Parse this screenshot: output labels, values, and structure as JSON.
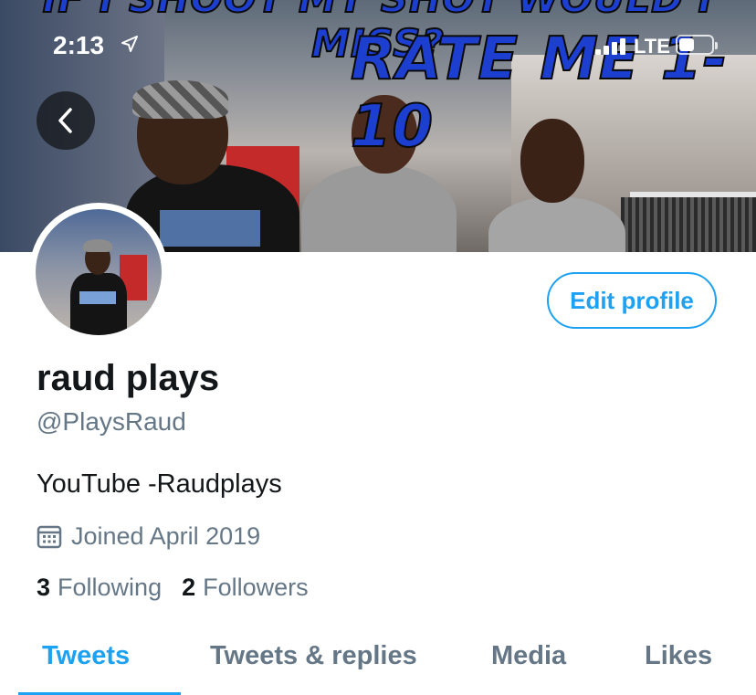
{
  "status_bar": {
    "time": "2:13",
    "network": "LTE",
    "icons": [
      "location-arrow-icon",
      "signal-bars-icon",
      "battery-icon"
    ]
  },
  "header_image": {
    "overlay_text_top": "IF I SHOOT MY SHOT WOULD I MISS?",
    "overlay_text_main": "RATE ME 1-10"
  },
  "nav": {
    "back_icon": "chevron-left-icon"
  },
  "profile": {
    "edit_button": "Edit profile",
    "display_name": "raud plays",
    "handle": "@PlaysRaud",
    "bio": "YouTube -Raudplays",
    "joined_icon": "calendar-icon",
    "joined": "Joined April 2019",
    "following_count": "3",
    "following_label": "Following",
    "followers_count": "2",
    "followers_label": "Followers"
  },
  "tabs": [
    {
      "label": "Tweets",
      "active": true
    },
    {
      "label": "Tweets & replies",
      "active": false
    },
    {
      "label": "Media",
      "active": false
    },
    {
      "label": "Likes",
      "active": false
    }
  ],
  "colors": {
    "accent": "#1da1f2",
    "secondary_text": "#657786",
    "primary_text": "#14171a",
    "overlay_blue": "#1d3fd0"
  }
}
